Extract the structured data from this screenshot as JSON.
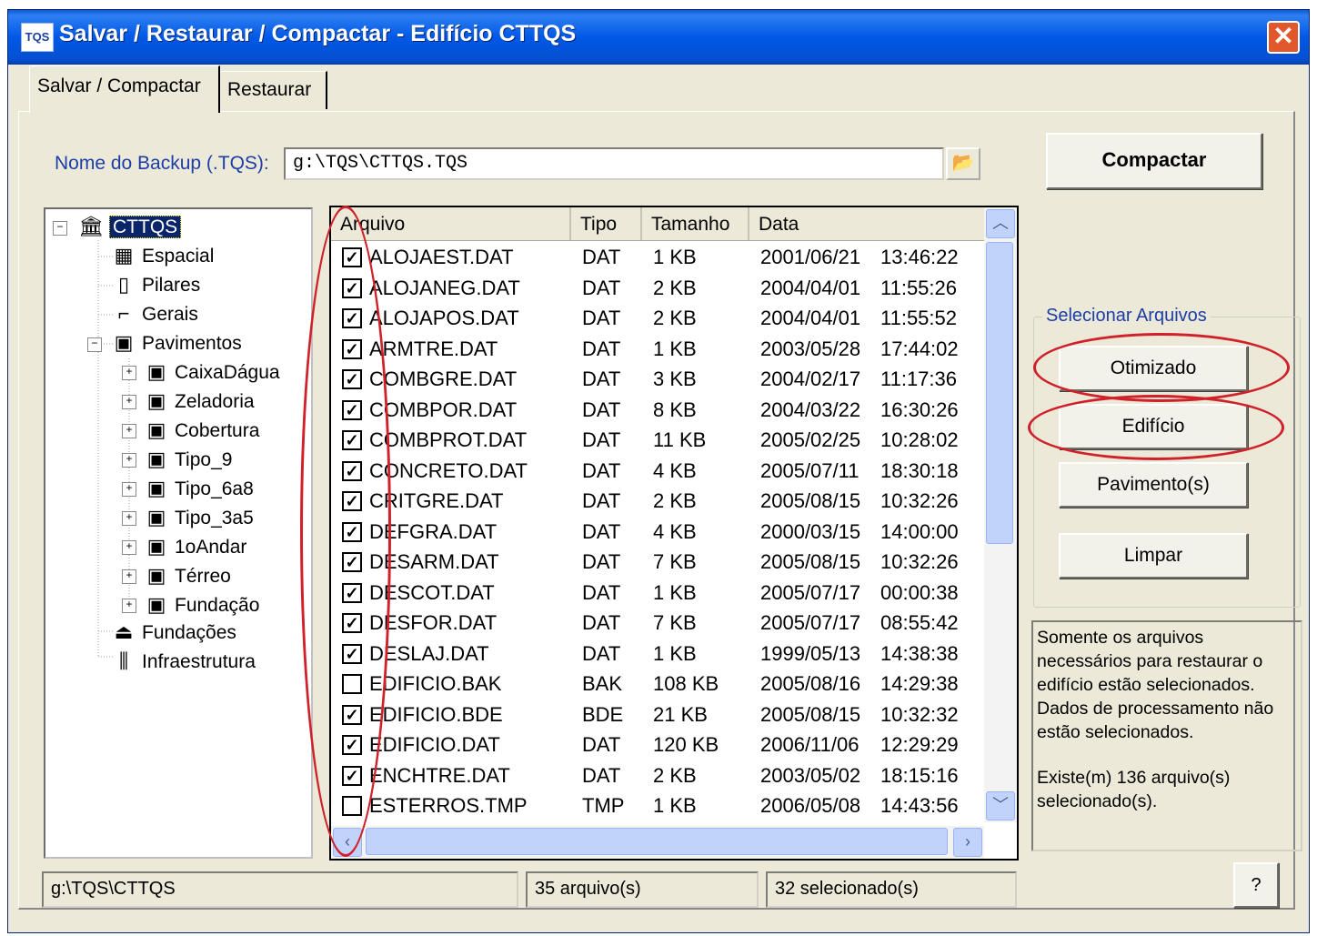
{
  "window": {
    "title": "Salvar / Restaurar / Compactar - Edifício CTTQS",
    "app_icon_text": "TQS"
  },
  "tabs": [
    {
      "label": "Salvar / Compactar"
    },
    {
      "label": "Restaurar"
    }
  ],
  "backup": {
    "label": "Nome do Backup (.TQS):",
    "value": "g:\\TQS\\CTTQS.TQS"
  },
  "buttons": {
    "compactar": "Compactar",
    "help": "?",
    "close": "✕"
  },
  "tree": {
    "root": "CTTQS",
    "items": [
      "Espacial",
      "Pilares",
      "Gerais",
      "Pavimentos"
    ],
    "pavimentos": [
      "CaixaDágua",
      "Zeladoria",
      "Cobertura",
      "Tipo_9",
      "Tipo_6a8",
      "Tipo_3a5",
      "1oAndar",
      "Térreo",
      "Fundação"
    ],
    "bottom": [
      "Fundações",
      "Infraestrutura"
    ]
  },
  "list": {
    "columns": [
      "Arquivo",
      "Tipo",
      "Tamanho",
      "Data"
    ],
    "rows": [
      {
        "checked": true,
        "name": "ALOJAEST.DAT",
        "type": "DAT",
        "size": "1 KB",
        "date": "2001/06/21",
        "time": "13:46:22"
      },
      {
        "checked": true,
        "name": "ALOJANEG.DAT",
        "type": "DAT",
        "size": "2 KB",
        "date": "2004/04/01",
        "time": "11:55:26"
      },
      {
        "checked": true,
        "name": "ALOJAPOS.DAT",
        "type": "DAT",
        "size": "2 KB",
        "date": "2004/04/01",
        "time": "11:55:52"
      },
      {
        "checked": true,
        "name": "ARMTRE.DAT",
        "type": "DAT",
        "size": "1 KB",
        "date": "2003/05/28",
        "time": "17:44:02"
      },
      {
        "checked": true,
        "name": "COMBGRE.DAT",
        "type": "DAT",
        "size": "3 KB",
        "date": "2004/02/17",
        "time": "11:17:36"
      },
      {
        "checked": true,
        "name": "COMBPOR.DAT",
        "type": "DAT",
        "size": "8 KB",
        "date": "2004/03/22",
        "time": "16:30:26"
      },
      {
        "checked": true,
        "name": "COMBPROT.DAT",
        "type": "DAT",
        "size": "11 KB",
        "date": "2005/02/25",
        "time": "10:28:02"
      },
      {
        "checked": true,
        "name": "CONCRETO.DAT",
        "type": "DAT",
        "size": "4 KB",
        "date": "2005/07/11",
        "time": "18:30:18"
      },
      {
        "checked": true,
        "name": "CRITGRE.DAT",
        "type": "DAT",
        "size": "2 KB",
        "date": "2005/08/15",
        "time": "10:32:26"
      },
      {
        "checked": true,
        "name": "DEFGRA.DAT",
        "type": "DAT",
        "size": "4 KB",
        "date": "2000/03/15",
        "time": "14:00:00"
      },
      {
        "checked": true,
        "name": "DESARM.DAT",
        "type": "DAT",
        "size": "7 KB",
        "date": "2005/08/15",
        "time": "10:32:26"
      },
      {
        "checked": true,
        "name": "DESCOT.DAT",
        "type": "DAT",
        "size": "1 KB",
        "date": "2005/07/17",
        "time": "00:00:38"
      },
      {
        "checked": true,
        "name": "DESFOR.DAT",
        "type": "DAT",
        "size": "7 KB",
        "date": "2005/07/17",
        "time": "08:55:42"
      },
      {
        "checked": true,
        "name": "DESLAJ.DAT",
        "type": "DAT",
        "size": "1 KB",
        "date": "1999/05/13",
        "time": "14:38:38"
      },
      {
        "checked": false,
        "name": "EDIFICIO.BAK",
        "type": "BAK",
        "size": "108 KB",
        "date": "2005/08/16",
        "time": "14:29:38"
      },
      {
        "checked": true,
        "name": "EDIFICIO.BDE",
        "type": "BDE",
        "size": "21 KB",
        "date": "2005/08/15",
        "time": "10:32:32"
      },
      {
        "checked": true,
        "name": "EDIFICIO.DAT",
        "type": "DAT",
        "size": "120 KB",
        "date": "2006/11/06",
        "time": "12:29:29"
      },
      {
        "checked": true,
        "name": "ENCHTRE.DAT",
        "type": "DAT",
        "size": "2 KB",
        "date": "2003/05/02",
        "time": "18:15:16"
      },
      {
        "checked": false,
        "name": "ESTERROS.TMP",
        "type": "TMP",
        "size": "1 KB",
        "date": "2006/05/08",
        "time": "14:43:56"
      }
    ]
  },
  "selecionar": {
    "title": "Selecionar Arquivos",
    "buttons": [
      "Otimizado",
      "Edifício",
      "Pavimento(s)",
      "Limpar"
    ]
  },
  "info": {
    "text": "Somente os arquivos necessários para restaurar o edifício estão selecionados. Dados de processamento não estão selecionados.",
    "count": "Existe(m) 136 arquivo(s) selecionado(s)."
  },
  "status": {
    "path": "g:\\TQS\\CTTQS",
    "files": "35 arquivo(s)",
    "selected": "32 selecionado(s)"
  },
  "colors": {
    "annotation": "#d0202a",
    "title_bar": "#0058e6",
    "label_blue": "#1c3ea8"
  }
}
